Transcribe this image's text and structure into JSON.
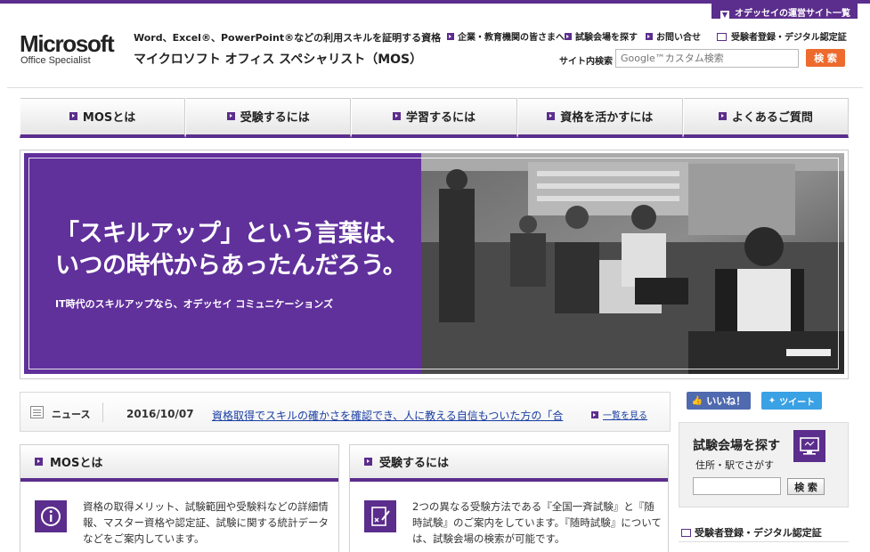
{
  "corner_tab": "オデッセイの運営サイト一覧",
  "header": {
    "logo": "Microsoft",
    "logo_sub": "Office Specialist",
    "tagline_line1": "Word、Excel®、PowerPoint®などの利用スキルを証明する資格",
    "tagline_line2": "マイクロソフト オフィス スペシャリスト（MOS）",
    "links": [
      "企業・教育機関の皆さまへ",
      "試験会場を探す",
      "お問い合せ"
    ],
    "register_link": "受験者登録・デジタル認定証",
    "search_label": "サイト内検索",
    "search_placeholder": "Google™カスタム検索",
    "search_button": "検 索"
  },
  "nav": [
    "MOSとは",
    "受験するには",
    "学習するには",
    "資格を活かすには",
    "よくあるご質問"
  ],
  "hero": {
    "headline_line1": "「スキルアップ」という言葉は、",
    "headline_line2": "いつの時代からあったんだろう。",
    "subline": "IT時代のスキルアップなら、オデッセイ コミュニケーションズ"
  },
  "news": {
    "label": "ニュース",
    "date": "2016/10/07",
    "headline": "資格取得でスキルの確かさを確認でき、人に教える自信もついた方の「合",
    "more": "一覧を見る"
  },
  "boxes": [
    {
      "title": "MOSとは",
      "text": "資格の取得メリット、試験範囲や受験料などの詳細情報、マスター資格や認定証、試験に関する統計データなどをご案内しています。"
    },
    {
      "title": "受験するには",
      "text": "2つの異なる受験方法である『全国一斉試験』と『随時試験』のご案内をしています。『随時試験』については、試験会場の検索が可能です。"
    }
  ],
  "social": {
    "like": "いいね！",
    "tweet": "ツイート"
  },
  "exam_search": {
    "title": "試験会場を探す",
    "subtitle": "住所・駅でさがす",
    "button": "検 索"
  },
  "sidebar_register": "受験者登録・デジタル認定証",
  "colors": {
    "brand_purple": "#5b2d8c",
    "search_orange": "#ec6b2d",
    "link_blue": "#1a3ea3"
  }
}
